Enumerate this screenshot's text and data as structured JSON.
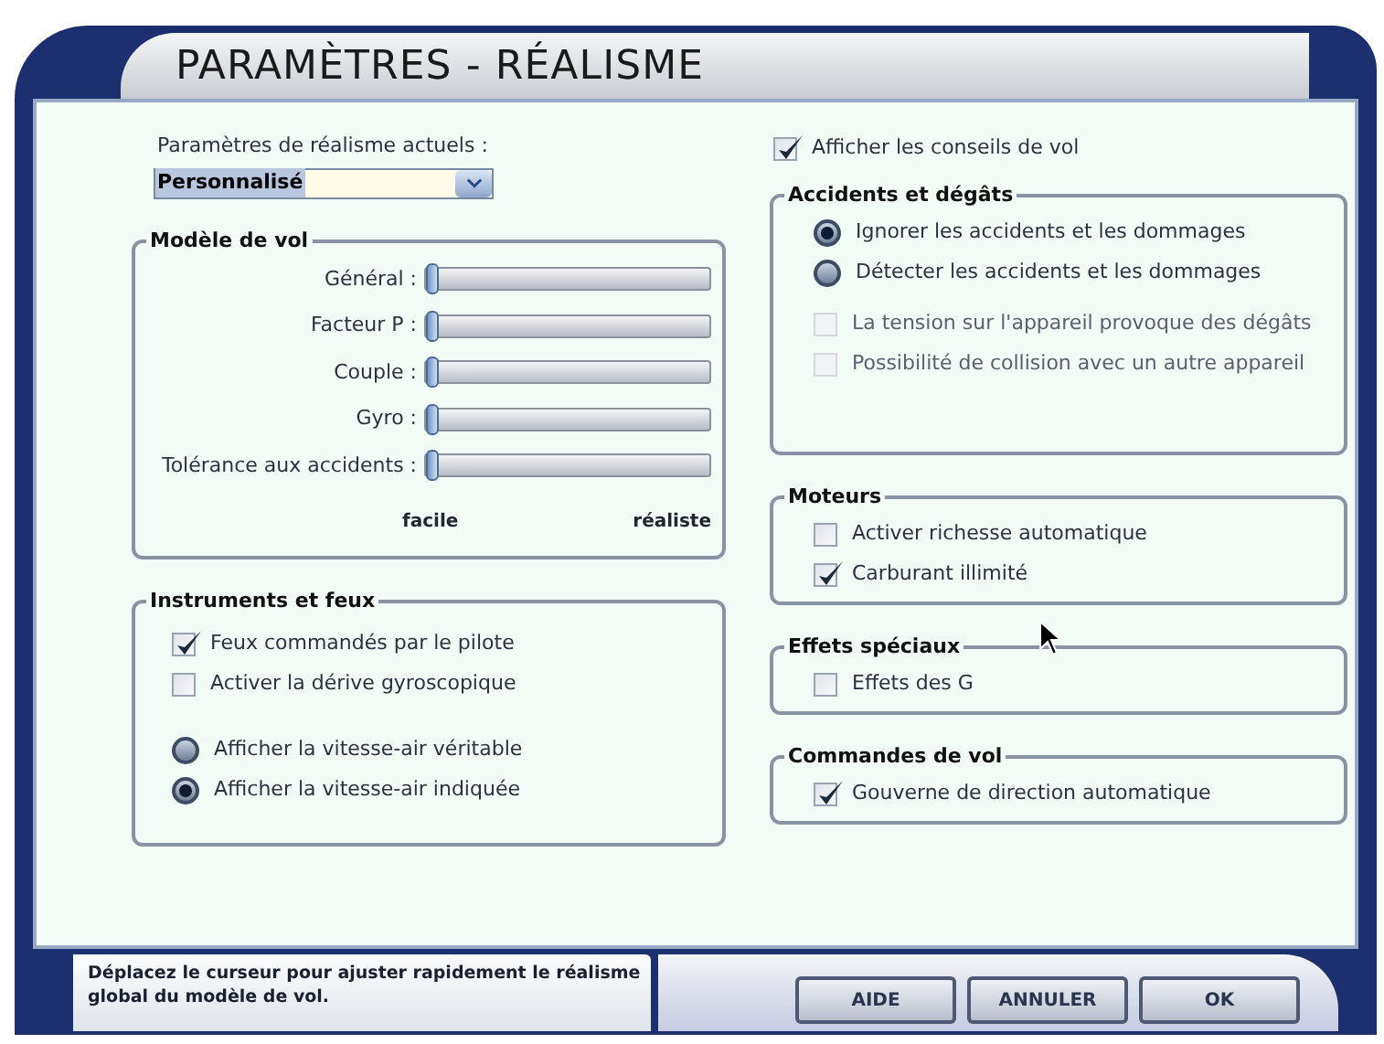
{
  "window": {
    "title": "PARAMÈTRES - RÉALISME"
  },
  "preset": {
    "label": "Paramètres de réalisme actuels :",
    "value": "Personnalisé"
  },
  "flight_model": {
    "title": "Modèle de vol",
    "sliders": [
      {
        "label": "Général :",
        "level": 0
      },
      {
        "label": "Facteur P :",
        "level": 0
      },
      {
        "label": "Couple :",
        "level": 0
      },
      {
        "label": "Gyro :",
        "level": 0
      },
      {
        "label": "Tolérance aux accidents :",
        "level": 0
      }
    ],
    "min_label": "facile",
    "max_label": "réaliste"
  },
  "instruments": {
    "title": "Instruments et feux",
    "options": [
      {
        "kind": "checkbox",
        "label": "Feux commandés par le pilote",
        "checked": true
      },
      {
        "kind": "checkbox",
        "label": "Activer la dérive gyroscopique",
        "checked": false
      },
      {
        "kind": "radio",
        "label": "Afficher la vitesse-air véritable",
        "selected": false
      },
      {
        "kind": "radio",
        "label": "Afficher la vitesse-air indiquée",
        "selected": true
      }
    ]
  },
  "flight_tips": {
    "kind": "checkbox",
    "label": "Afficher les conseils de vol",
    "checked": true
  },
  "groups": [
    {
      "title": "Accidents et dégâts",
      "options": [
        {
          "kind": "radio",
          "label": "Ignorer les accidents et les dommages",
          "selected": true,
          "disabled": false
        },
        {
          "kind": "radio",
          "label": "Détecter les accidents et les dommages",
          "selected": false,
          "disabled": false
        },
        {
          "kind": "checkbox",
          "label": "La tension sur l'appareil provoque des dégâts",
          "checked": false,
          "disabled": true
        },
        {
          "kind": "checkbox",
          "label": "Possibilité de collision avec un autre appareil",
          "checked": false,
          "disabled": true
        }
      ]
    },
    {
      "title": "Moteurs",
      "options": [
        {
          "kind": "checkbox",
          "label": "Activer richesse automatique",
          "checked": false,
          "disabled": false
        },
        {
          "kind": "checkbox",
          "label": "Carburant illimité",
          "checked": true,
          "disabled": false
        }
      ]
    },
    {
      "title": "Effets spéciaux",
      "options": [
        {
          "kind": "checkbox",
          "label": "Effets des G",
          "checked": false,
          "disabled": false
        }
      ]
    },
    {
      "title": "Commandes de vol",
      "options": [
        {
          "kind": "checkbox",
          "label": "Gouverne de direction automatique",
          "checked": true,
          "disabled": false
        }
      ]
    }
  ],
  "help_text": "Déplacez le curseur pour ajuster rapidement le réalisme global du modèle de vol.",
  "buttons": [
    "AIDE",
    "ANNULER",
    "OK"
  ]
}
